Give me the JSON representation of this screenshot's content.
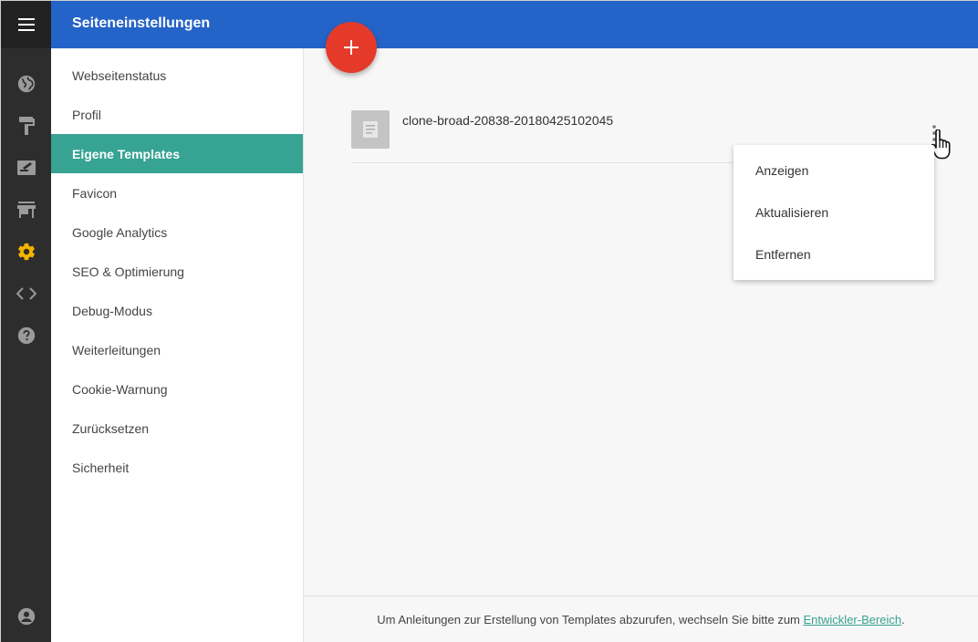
{
  "header": {
    "title": "Seiteneinstellungen"
  },
  "rail": {
    "icons": [
      "menu-icon",
      "globe-icon",
      "paint-roller-icon",
      "edit-note-icon",
      "store-icon",
      "gear-icon",
      "code-icon",
      "help-icon",
      "account-icon"
    ],
    "active_color": "#f2b400",
    "inactive_color": "#9a9a9a"
  },
  "sidebar": {
    "items": [
      {
        "label": "Webseitenstatus"
      },
      {
        "label": "Profil"
      },
      {
        "label": "Eigene Templates"
      },
      {
        "label": "Favicon"
      },
      {
        "label": "Google Analytics"
      },
      {
        "label": "SEO & Optimierung"
      },
      {
        "label": "Debug-Modus"
      },
      {
        "label": "Weiterleitungen"
      },
      {
        "label": "Cookie-Warnung"
      },
      {
        "label": "Zurücksetzen"
      },
      {
        "label": "Sicherheit"
      }
    ],
    "active_label": "Eigene Templates"
  },
  "templates": [
    {
      "name": "clone-broad-20838-20180425102045"
    }
  ],
  "context_menu": {
    "items": [
      {
        "label": "Anzeigen"
      },
      {
        "label": "Aktualisieren"
      },
      {
        "label": "Entfernen"
      }
    ]
  },
  "fab": {
    "label": "+",
    "color": "#e53a2a"
  },
  "footer": {
    "text": "Um Anleitungen zur Erstellung von Templates abzurufen, wechseln Sie bitte zum",
    "link": "Entwickler-Bereich",
    "end": "."
  },
  "colors": {
    "header": "#2463c7",
    "accent": "#36a393",
    "rail": "#2d2d2d"
  }
}
